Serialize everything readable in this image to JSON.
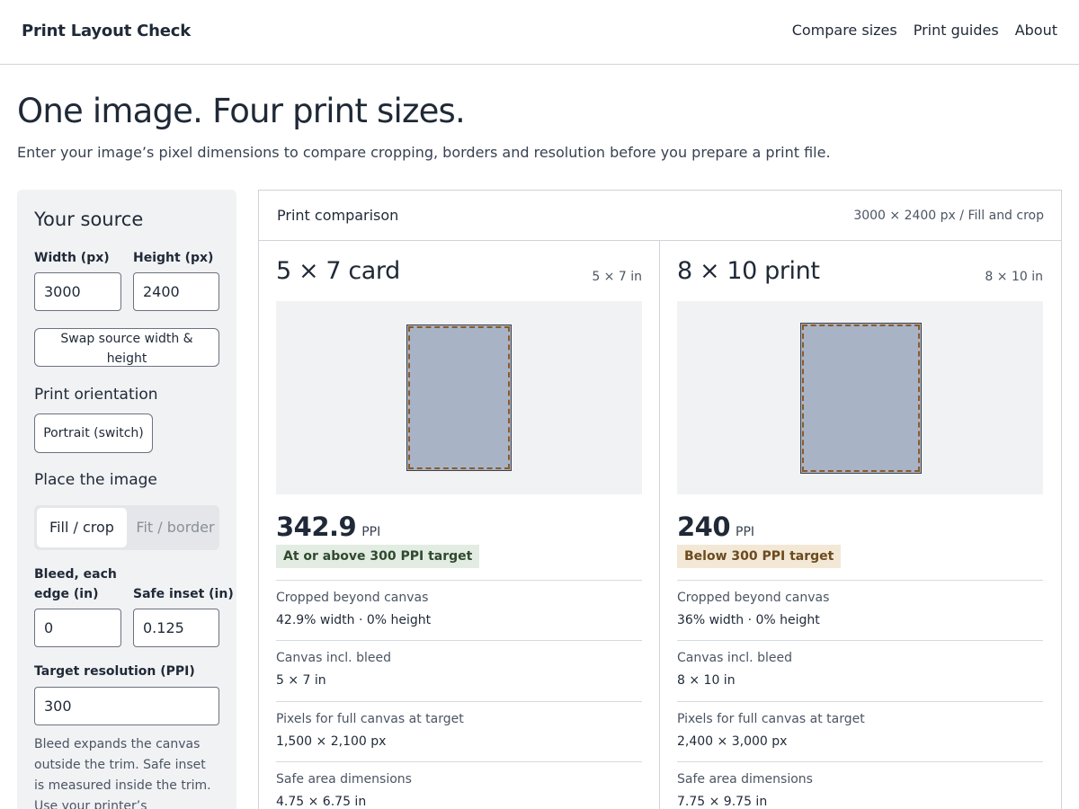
{
  "header": {
    "brand": "Print Layout Check",
    "nav": [
      "Compare sizes",
      "Print guides",
      "About"
    ]
  },
  "page": {
    "title": "One image. Four print sizes.",
    "subtitle": "Enter your image’s pixel dimensions to compare cropping, borders and resolution before you prepare a print file."
  },
  "sidebar": {
    "title": "Your source",
    "width_label": "Width (px)",
    "width_value": "3000",
    "height_label": "Height (px)",
    "height_value": "2400",
    "swap_button": "Swap source width & height",
    "orientation_heading": "Print orientation",
    "orientation_button": "Portrait (switch)",
    "place_heading": "Place the image",
    "place_options": [
      "Fill / crop",
      "Fit / border"
    ],
    "place_selected": "Fill / crop",
    "bleed_label": "Bleed, each edge (in)",
    "bleed_value": "0",
    "safe_label": "Safe inset (in)",
    "safe_value": "0.125",
    "target_label": "Target resolution (PPI)",
    "target_value": "300",
    "help": "Bleed expands the canvas outside the trim. Safe inset is measured inside the trim. Use your printer’s specifications:"
  },
  "comparison": {
    "title": "Print comparison",
    "meta": "3000 × 2400 px / Fill and crop",
    "cards": [
      {
        "title": "5 × 7 card",
        "size": "5 × 7 in",
        "ppi": "342.9",
        "ppi_unit": "PPI",
        "status": "At or above 300 PPI target",
        "status_kind": "good",
        "rows": [
          {
            "label": "Cropped beyond canvas",
            "value": "42.9% width · 0% height"
          },
          {
            "label": "Canvas incl. bleed",
            "value": "5 × 7 in"
          },
          {
            "label": "Pixels for full canvas at target",
            "value": "1,500 × 2,100 px"
          },
          {
            "label": "Safe area dimensions",
            "value": "4.75 × 6.75 in"
          }
        ]
      },
      {
        "title": "8 × 10 print",
        "size": "8 × 10 in",
        "ppi": "240",
        "ppi_unit": "PPI",
        "status": "Below 300 PPI target",
        "status_kind": "warn",
        "rows": [
          {
            "label": "Cropped beyond canvas",
            "value": "36% width · 0% height"
          },
          {
            "label": "Canvas incl. bleed",
            "value": "8 × 10 in"
          },
          {
            "label": "Pixels for full canvas at target",
            "value": "2,400 × 3,000 px"
          },
          {
            "label": "Safe area dimensions",
            "value": "7.75 × 9.75 in"
          }
        ]
      }
    ]
  },
  "colors": {
    "canvas_fill": "#a8b4c6",
    "safe_dash": "#8a5a2b",
    "good_badge": "#e3ece2",
    "warn_badge": "#f3e8d6"
  }
}
